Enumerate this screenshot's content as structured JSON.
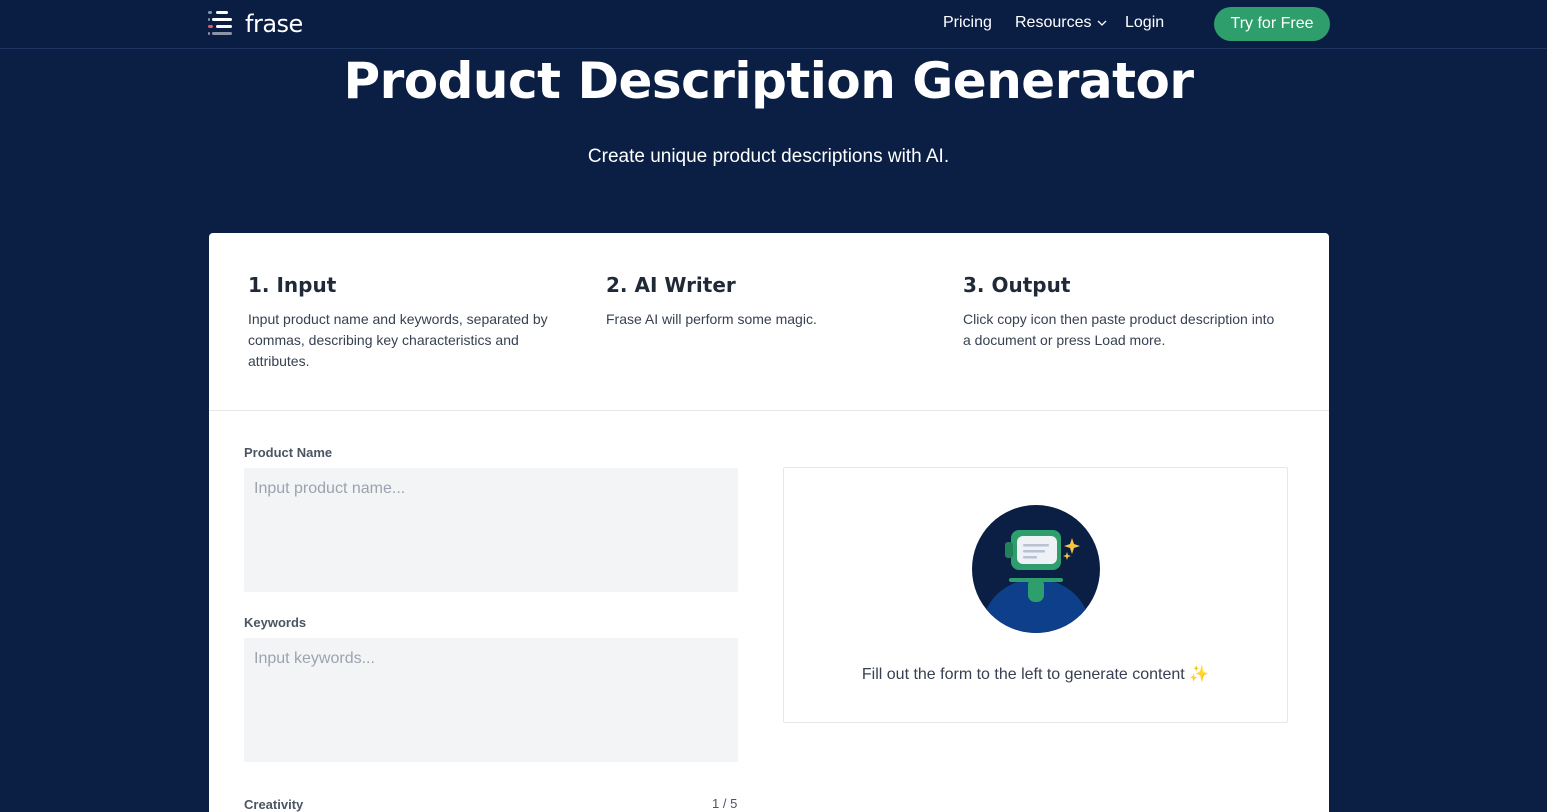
{
  "nav": {
    "logo_text": "frase",
    "links": {
      "pricing": "Pricing",
      "resources": "Resources",
      "login": "Login"
    },
    "cta": "Try for Free"
  },
  "hero": {
    "title": "Product Description Generator",
    "subtitle": "Create unique product descriptions with AI."
  },
  "steps": [
    {
      "title": "1. Input",
      "text": "Input product name and keywords, separated by commas, describing key characteristics and attributes."
    },
    {
      "title": "2. AI Writer",
      "text": "Frase AI will perform some magic."
    },
    {
      "title": "3. Output",
      "text": "Click copy icon then paste product description into a document or press Load more."
    }
  ],
  "form": {
    "product_name_label": "Product Name",
    "product_name_placeholder": "Input product name...",
    "keywords_label": "Keywords",
    "keywords_placeholder": "Input keywords...",
    "creativity_label": "Creativity",
    "creativity_value": "1 / 5"
  },
  "output": {
    "message": "Fill out the form to the left to generate content ✨"
  },
  "colors": {
    "background": "#0b1f45",
    "accent": "#2e9e6c",
    "card": "#ffffff"
  }
}
